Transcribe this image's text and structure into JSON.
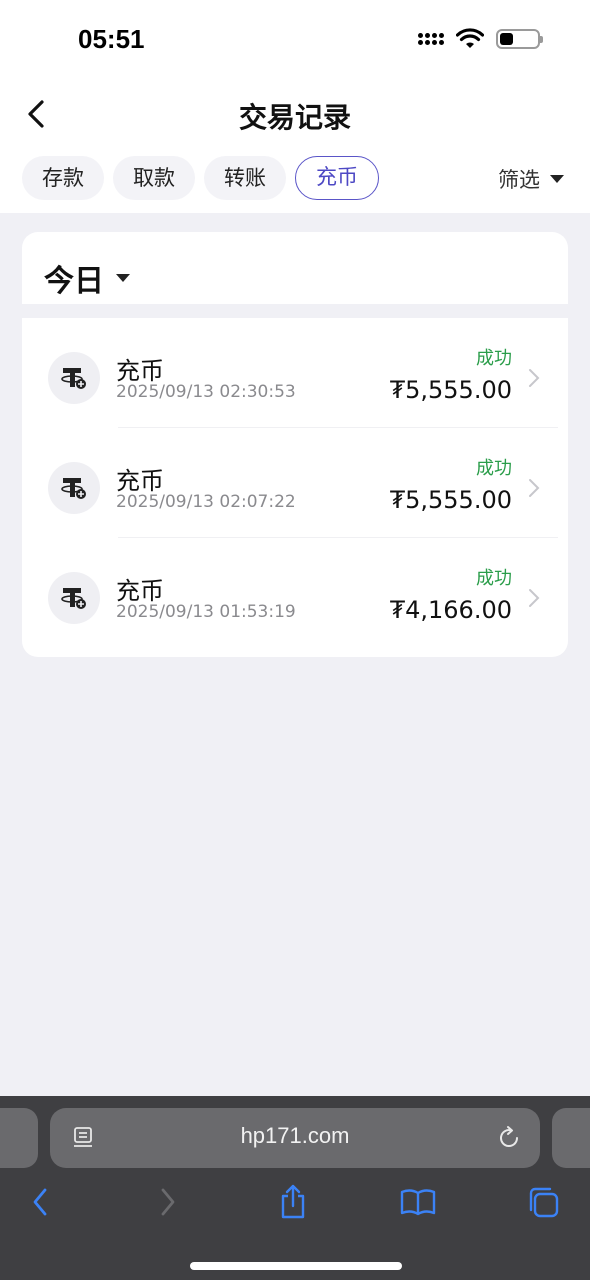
{
  "status_bar": {
    "time": "05:51",
    "battery_percent": 35
  },
  "header": {
    "title": "交易记录"
  },
  "tabs": [
    {
      "label": "存款",
      "active": false
    },
    {
      "label": "取款",
      "active": false
    },
    {
      "label": "转账",
      "active": false
    },
    {
      "label": "充币",
      "active": true
    }
  ],
  "filter": {
    "label": "筛选"
  },
  "date_group": {
    "label": "今日"
  },
  "transactions": [
    {
      "type": "充币",
      "time": "2025/09/13 02:30:53",
      "status": "成功",
      "amount": "₮5,555.00",
      "icon": "tether-icon"
    },
    {
      "type": "充币",
      "time": "2025/09/13 02:07:22",
      "status": "成功",
      "amount": "₮5,555.00",
      "icon": "tether-icon"
    },
    {
      "type": "充币",
      "time": "2025/09/13 01:53:19",
      "status": "成功",
      "amount": "₮4,166.00",
      "icon": "tether-icon"
    }
  ],
  "browser": {
    "url": "hp171.com"
  },
  "colors": {
    "accent": "#4d48c4",
    "success": "#2a9d4a",
    "browser_bg": "#3f3f42",
    "icon_blue": "#3b82f6"
  }
}
